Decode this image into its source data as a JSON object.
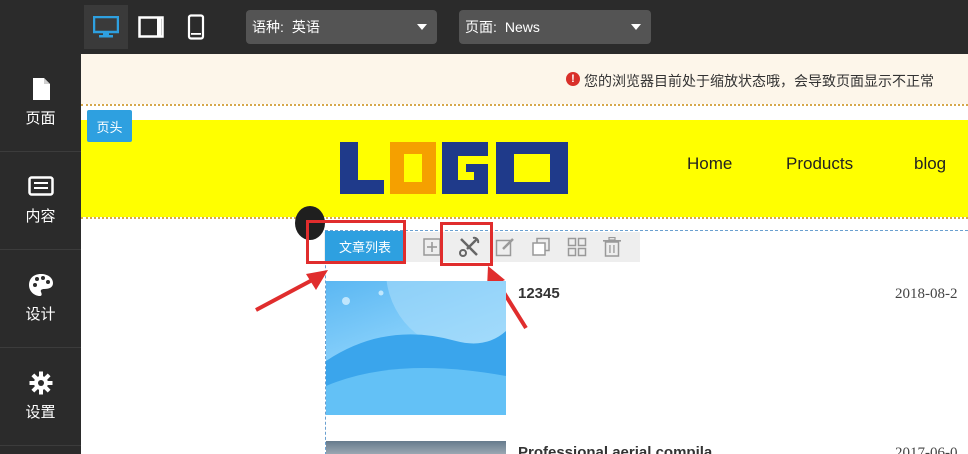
{
  "toolbar": {
    "language_select": {
      "label": "语种:",
      "value": "英语"
    },
    "page_select": {
      "label": "页面:",
      "value": "News"
    },
    "devices": [
      "desktop-icon",
      "tablet-icon",
      "mobile-icon"
    ]
  },
  "sidebar": {
    "items": [
      {
        "label": "页面",
        "icon": "file-icon"
      },
      {
        "label": "内容",
        "icon": "list-icon"
      },
      {
        "label": "设计",
        "icon": "palette-icon"
      },
      {
        "label": "设置",
        "icon": "gear-icon"
      }
    ]
  },
  "notice": {
    "text": "您的浏览器目前处于缩放状态哦，会导致页面显示不正常"
  },
  "header": {
    "tag": "页头",
    "logo": "LOGO",
    "nav": [
      "Home",
      "Products",
      "blog"
    ]
  },
  "module": {
    "tag": "文章列表",
    "tools": [
      "add-icon",
      "settings-wrench-icon",
      "edit-icon",
      "copy-icon",
      "grid-icon",
      "delete-icon"
    ]
  },
  "articles": [
    {
      "title": "12345",
      "date": "2018-08-2"
    },
    {
      "title": "Professional aerial compila",
      "date": "2017-06-0"
    }
  ],
  "colors": {
    "toolbar_bg": "#2b2b2b",
    "accent_blue": "#2ea0e0",
    "header_yellow": "#ffff00",
    "highlight_red": "#e02d2d"
  }
}
